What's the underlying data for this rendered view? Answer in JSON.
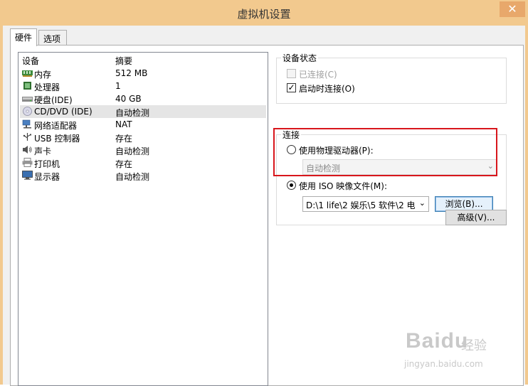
{
  "window": {
    "title": "虚拟机设置",
    "close_glyph": "✕"
  },
  "tabs": [
    {
      "label": "硬件"
    },
    {
      "label": "选项"
    }
  ],
  "device_list": {
    "headers": {
      "device": "设备",
      "summary": "摘要"
    },
    "rows": [
      {
        "name": "内存",
        "summary": "512 MB",
        "icon": "memory-icon"
      },
      {
        "name": "处理器",
        "summary": "1",
        "icon": "processor-icon"
      },
      {
        "name": "硬盘(IDE)",
        "summary": "40 GB",
        "icon": "hard-disk-icon"
      },
      {
        "name": "CD/DVD (IDE)",
        "summary": "自动检测",
        "icon": "cd-dvd-icon",
        "selected": true
      },
      {
        "name": "网络适配器",
        "summary": "NAT",
        "icon": "network-adapter-icon"
      },
      {
        "name": "USB 控制器",
        "summary": "存在",
        "icon": "usb-icon"
      },
      {
        "name": "声卡",
        "summary": "自动检测",
        "icon": "sound-card-icon"
      },
      {
        "name": "打印机",
        "summary": "存在",
        "icon": "printer-icon"
      },
      {
        "name": "显示器",
        "summary": "自动检测",
        "icon": "display-icon"
      }
    ]
  },
  "device_status": {
    "label": "设备状态",
    "connected": {
      "label": "已连接(C)",
      "checked": false,
      "disabled": true
    },
    "connect_at_power_on": {
      "label": "启动时连接(O)",
      "checked": true
    }
  },
  "connection": {
    "label": "连接",
    "use_physical_drive": {
      "label": "使用物理驱动器(P):",
      "selected": false
    },
    "physical_drive_select": {
      "value": "自动检测",
      "disabled": true
    },
    "use_iso_image": {
      "label": "使用 ISO 映像文件(M):",
      "selected": true
    },
    "iso_path_select": {
      "value": "D:\\1 life\\2 娱乐\\5 软件\\2 电"
    },
    "browse_button": "浏览(B)...",
    "advanced_button": "高级(V)..."
  },
  "watermark": {
    "brand": "Baidu",
    "text": "经验",
    "url": "jingyan.baidu.com"
  },
  "colors": {
    "title_bar": "#f2c98e",
    "highlight_border": "#d8161c",
    "selected_row": "#e5e5e5"
  }
}
